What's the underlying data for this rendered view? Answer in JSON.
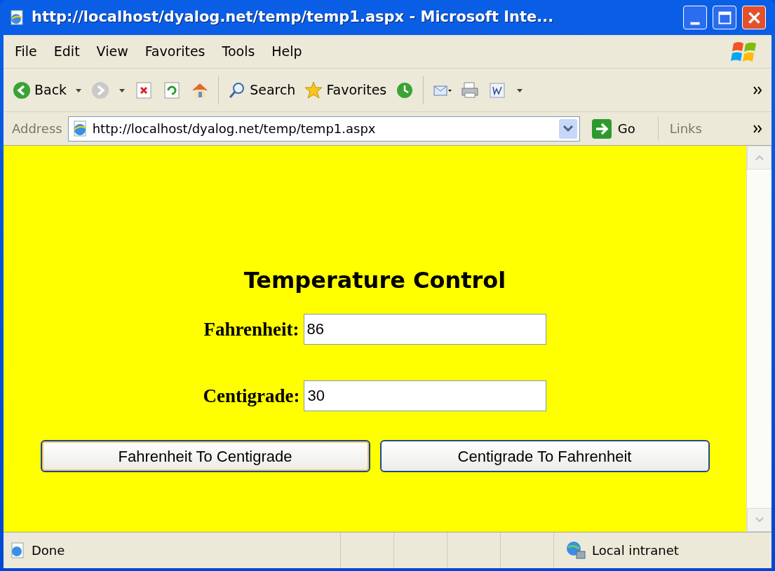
{
  "window": {
    "title": "http://localhost/dyalog.net/temp/temp1.aspx - Microsoft Inte..."
  },
  "menu": [
    "File",
    "Edit",
    "View",
    "Favorites",
    "Tools",
    "Help"
  ],
  "toolbar": [
    {
      "kind": "back",
      "label": "Back"
    },
    {
      "kind": "forward"
    },
    {
      "kind": "stop"
    },
    {
      "kind": "refresh"
    },
    {
      "kind": "home"
    },
    {
      "kind": "search",
      "label": "Search"
    },
    {
      "kind": "favorites",
      "label": "Favorites"
    },
    {
      "kind": "history"
    },
    {
      "kind": "mail"
    },
    {
      "kind": "print"
    },
    {
      "kind": "word"
    }
  ],
  "address": {
    "label": "Address",
    "url": "http://localhost/dyalog.net/temp/temp1.aspx",
    "go": "Go",
    "links": "Links"
  },
  "page": {
    "heading": "Temperature Control",
    "fields": [
      {
        "label": "Fahrenheit:",
        "value": "86"
      },
      {
        "label": "Centigrade:",
        "value": "30"
      }
    ],
    "buttons": [
      "Fahrenheit To Centigrade",
      "Centigrade To Fahrenheit"
    ]
  },
  "status_bar": {
    "text": "Done",
    "zone": "Local intranet"
  }
}
